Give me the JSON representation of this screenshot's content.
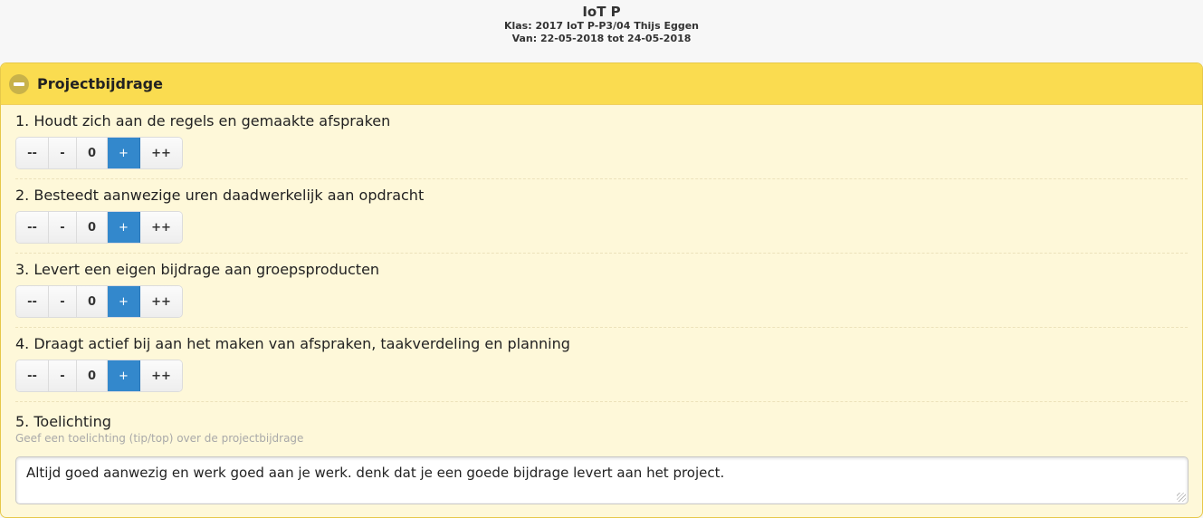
{
  "header": {
    "title": "IoT P",
    "klas": "Klas: 2017 IoT P-P3/04 Thijs Eggen",
    "van": "Van: 22-05-2018 tot 24-05-2018"
  },
  "panel": {
    "title": "Projectbijdrage",
    "collapse_icon": "minus-circle-icon"
  },
  "rating_options": [
    "--",
    "-",
    "0",
    "+",
    "++"
  ],
  "questions": [
    {
      "label": "1. Houdt zich aan de regels en gemaakte afspraken",
      "selected": "+"
    },
    {
      "label": "2. Besteedt aanwezige uren daadwerkelijk aan opdracht",
      "selected": "+"
    },
    {
      "label": "3. Levert een eigen bijdrage aan groepsproducten",
      "selected": "+"
    },
    {
      "label": "4. Draagt actief bij aan het maken van afspraken, taakverdeling en planning",
      "selected": "+"
    }
  ],
  "comment": {
    "label": "5. Toelichting",
    "hint": "Geef een toelichting (tip/top) over de projectbijdrage",
    "value": "Altijd goed aanwezig en werk goed aan je werk. denk dat je een goede bijdrage levert aan het project."
  },
  "colors": {
    "panel_header": "#fadc50",
    "panel_body": "#fef8d9",
    "active": "#3388cc"
  }
}
